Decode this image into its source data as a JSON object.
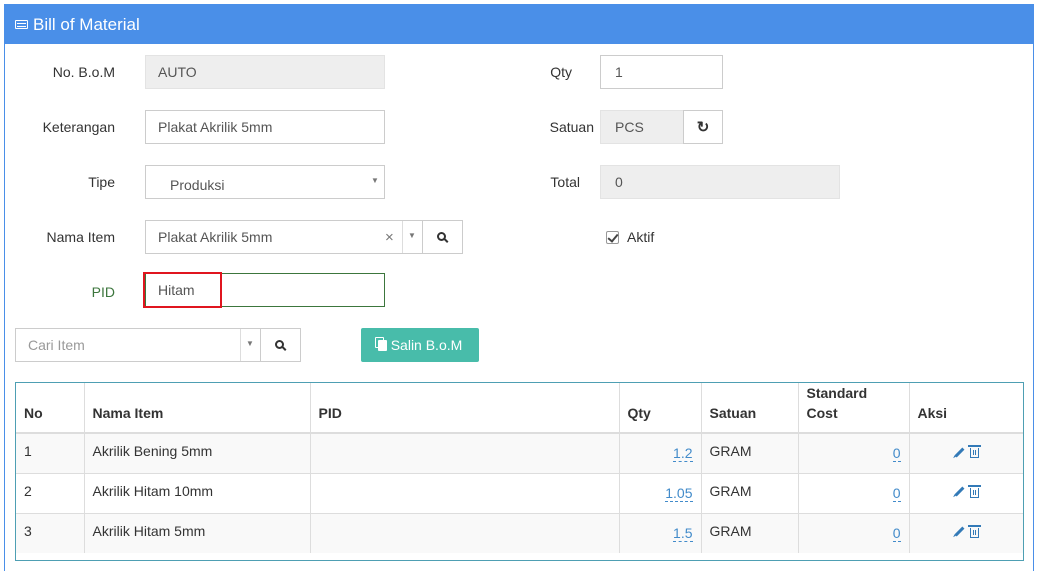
{
  "header": {
    "title": "Bill of Material",
    "icon": "list-alt-icon"
  },
  "form": {
    "no_bom": {
      "label": "No. B.o.M",
      "value": "AUTO"
    },
    "keterangan": {
      "label": "Keterangan",
      "value": "Plakat Akrilik 5mm"
    },
    "tipe": {
      "label": "Tipe",
      "value": "Produksi"
    },
    "nama_item": {
      "label": "Nama Item",
      "value": "Plakat Akrilik 5mm",
      "clear": "×"
    },
    "pid": {
      "label": "PID",
      "value": "Hitam"
    },
    "qty": {
      "label": "Qty",
      "value": "1"
    },
    "satuan": {
      "label": "Satuan",
      "value": "PCS"
    },
    "total": {
      "label": "Total",
      "value": "0"
    },
    "aktif": {
      "label": "Aktif",
      "checked": true
    }
  },
  "search": {
    "placeholder": "Cari Item"
  },
  "salin_button": "Salin B.o.M",
  "table": {
    "headers": {
      "no": "No",
      "nama_item": "Nama Item",
      "pid": "PID",
      "qty": "Qty",
      "satuan": "Satuan",
      "standard_cost_1": "Standard",
      "standard_cost_2": "Cost",
      "aksi": "Aksi"
    },
    "rows": [
      {
        "no": "1",
        "nama_item": "Akrilik Bening 5mm",
        "pid": "",
        "qty": "1.2",
        "satuan": "GRAM",
        "cost": "0"
      },
      {
        "no": "2",
        "nama_item": "Akrilik Hitam 10mm",
        "pid": "",
        "qty": "1.05",
        "satuan": "GRAM",
        "cost": "0"
      },
      {
        "no": "3",
        "nama_item": "Akrilik Hitam 5mm",
        "pid": "",
        "qty": "1.5",
        "satuan": "GRAM",
        "cost": "0"
      }
    ]
  },
  "colors": {
    "header": "#4a8fe8",
    "salin_button": "#48bcaa",
    "highlight": "#e0151f",
    "link": "#428bca"
  }
}
